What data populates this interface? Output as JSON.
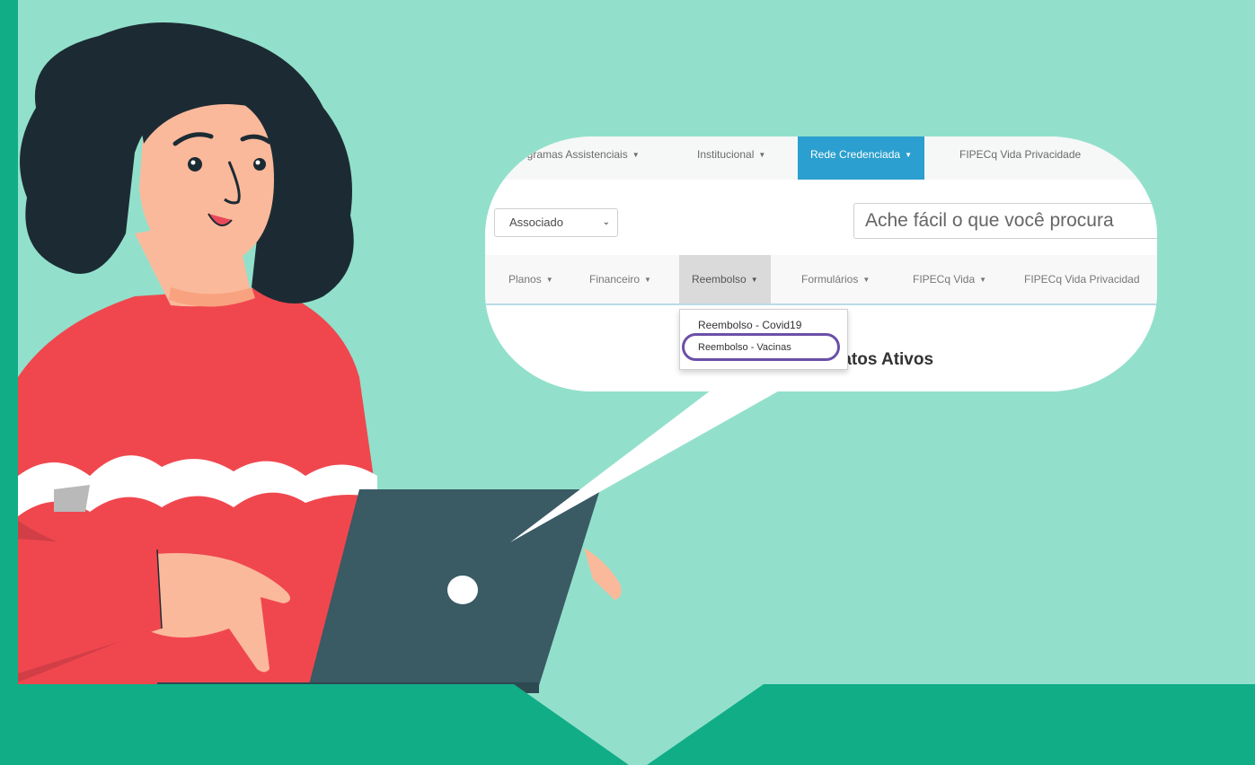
{
  "top_nav": {
    "items": [
      {
        "label": "rogramas Assistenciais"
      },
      {
        "label": "Institucional"
      },
      {
        "label": "Rede Credenciada"
      },
      {
        "label": "FIPECq Vida Privacidade"
      }
    ],
    "active_color": "#2b9fcf"
  },
  "profile_select": {
    "value": "Associado"
  },
  "search": {
    "placeholder": "Ache fácil o que você procura"
  },
  "sub_nav": {
    "items": [
      {
        "label": "Planos"
      },
      {
        "label": "Financeiro"
      },
      {
        "label": "Reembolso"
      },
      {
        "label": "Formulários"
      },
      {
        "label": "FIPECq Vida"
      },
      {
        "label": "FIPECq Vida Privacidad"
      }
    ]
  },
  "dropdown": {
    "items": [
      {
        "label": "Reembolso - Covid19"
      },
      {
        "label": "Reembolso - Vacinas"
      }
    ],
    "highlight_color": "#6b4fa8"
  },
  "heading": "ntratos Ativos",
  "colors": {
    "background": "#92e0cb",
    "band": "#11ad87",
    "sweater": "#f0474f",
    "laptop": "#3a5a64",
    "hair": "#1c2b33",
    "skin": "#fbb99b"
  }
}
